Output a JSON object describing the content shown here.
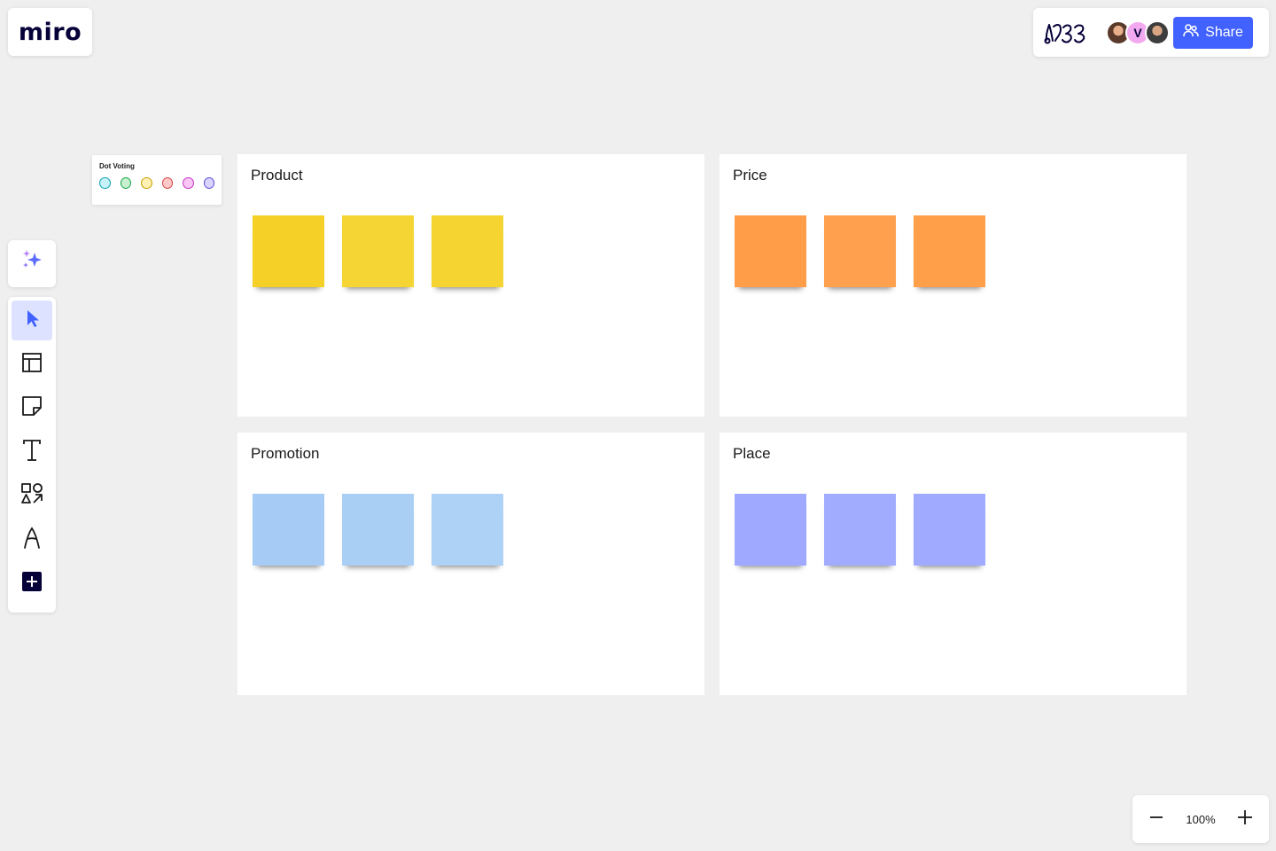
{
  "app": {
    "logo_text": "miro"
  },
  "topbar": {
    "avatars": [
      {
        "initial": "",
        "name": "avatar-photo-1"
      },
      {
        "initial": "V",
        "name": "avatar-v"
      },
      {
        "initial": "",
        "name": "avatar-photo-2"
      }
    ],
    "share_label": "Share"
  },
  "dot_voting": {
    "title": "Dot Voting",
    "dots": [
      {
        "fill": "#c6f1f7",
        "stroke": "#12a3b6"
      },
      {
        "fill": "#c8f0d0",
        "stroke": "#1aa64a"
      },
      {
        "fill": "#fff0b3",
        "stroke": "#c6a200"
      },
      {
        "fill": "#ffc8c8",
        "stroke": "#d64545"
      },
      {
        "fill": "#f8c6f5",
        "stroke": "#c538c2"
      },
      {
        "fill": "#d8d4ff",
        "stroke": "#5b4fd6"
      }
    ]
  },
  "toolbar": {
    "items": [
      {
        "name": "select-tool",
        "icon": "cursor-icon",
        "active": true
      },
      {
        "name": "templates-tool",
        "icon": "layout-icon",
        "active": false
      },
      {
        "name": "sticky-note-tool",
        "icon": "sticky-note-icon",
        "active": false
      },
      {
        "name": "text-tool",
        "icon": "text-icon",
        "active": false
      },
      {
        "name": "shapes-tool",
        "icon": "shapes-icon",
        "active": false
      },
      {
        "name": "pen-tool",
        "icon": "pen-icon",
        "active": false
      },
      {
        "name": "more-apps-tool",
        "icon": "plus-square-icon",
        "active": false
      }
    ]
  },
  "frames": [
    {
      "title": "Product",
      "note_color": "#f5d128",
      "notes": 3
    },
    {
      "title": "Price",
      "note_color": "#ff9d48",
      "notes": 3
    },
    {
      "title": "Promotion",
      "note_color": "#a6ccf5",
      "notes": 3
    },
    {
      "title": "Place",
      "note_color": "#9ea9ff",
      "notes": 3
    }
  ],
  "zoom": {
    "level": "100%"
  },
  "colors": {
    "accent": "#4262ff",
    "brand_dark": "#050038"
  }
}
